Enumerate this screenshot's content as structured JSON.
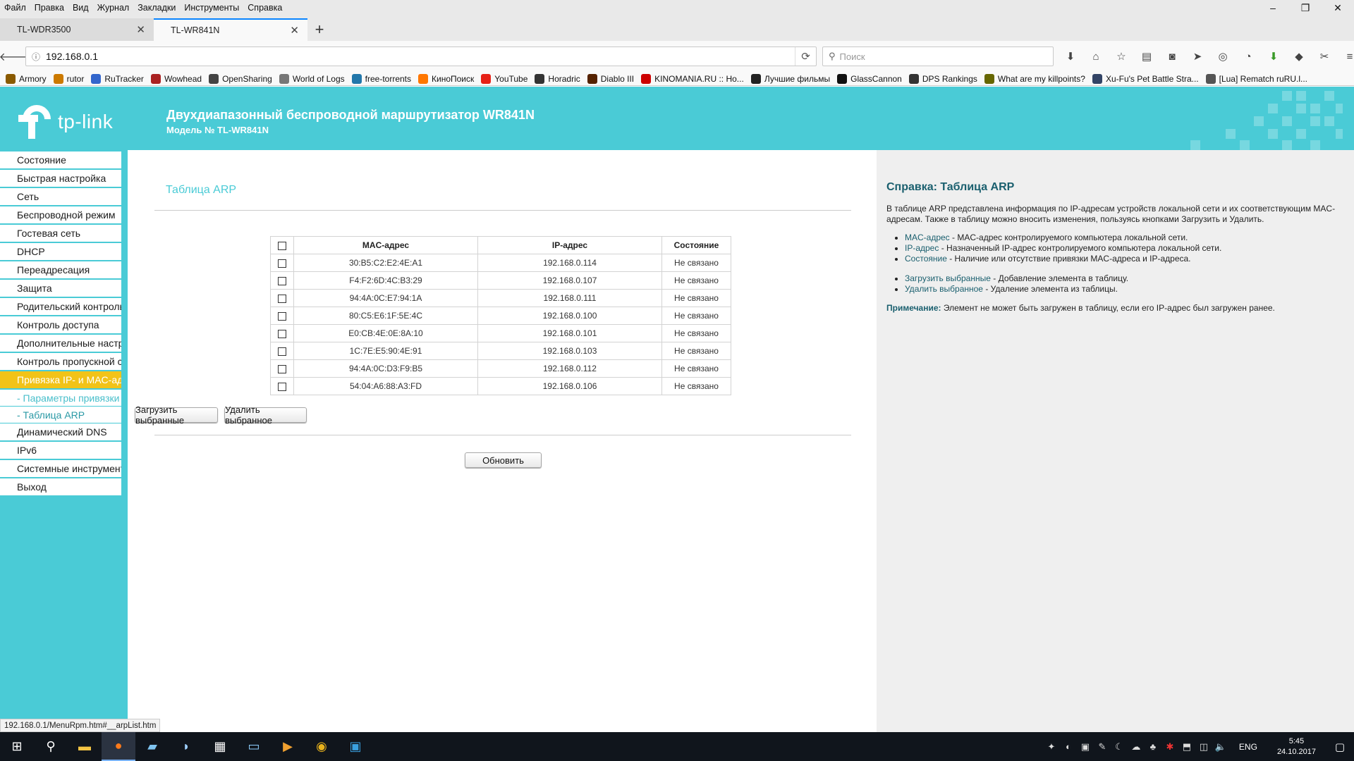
{
  "menubar": {
    "items": [
      "Файл",
      "Правка",
      "Вид",
      "Журнал",
      "Закладки",
      "Инструменты",
      "Справка"
    ],
    "window_controls": [
      "–",
      "❐",
      "✕"
    ]
  },
  "tabs": [
    {
      "title": "TL-WDR3500"
    },
    {
      "title": "TL-WR841N"
    }
  ],
  "navbar": {
    "url": "192.168.0.1",
    "search_placeholder": "Поиск"
  },
  "bookmarks": [
    {
      "label": "Armory",
      "color": "#8a5a00"
    },
    {
      "label": "rutor",
      "color": "#cc7a00"
    },
    {
      "label": "RuTracker",
      "color": "#3366cc"
    },
    {
      "label": "Wowhead",
      "color": "#aa2222"
    },
    {
      "label": "OpenSharing",
      "color": "#444444"
    },
    {
      "label": "World of Logs",
      "color": "#777777"
    },
    {
      "label": "free-torrents",
      "color": "#2277aa"
    },
    {
      "label": "КиноПоиск",
      "color": "#ff7700"
    },
    {
      "label": "YouTube",
      "color": "#e62117"
    },
    {
      "label": "Horadric",
      "color": "#333333"
    },
    {
      "label": "Diablo III",
      "color": "#552200"
    },
    {
      "label": "KINOMANIA.RU :: Ho...",
      "color": "#cc0000"
    },
    {
      "label": "Лучшие фильмы",
      "color": "#222222"
    },
    {
      "label": "GlassCannon",
      "color": "#111111"
    },
    {
      "label": "DPS Rankings",
      "color": "#333333"
    },
    {
      "label": "What are my killpoints?",
      "color": "#666600"
    },
    {
      "label": "Xu-Fu's Pet Battle Stra...",
      "color": "#334466"
    },
    {
      "label": "[Lua] Rematch ruRU.l...",
      "color": "#555555"
    }
  ],
  "header": {
    "brand": "tp-link",
    "title": "Двухдиапазонный беспроводной маршрутизатор WR841N",
    "model": "Модель № TL-WR841N"
  },
  "sidebar": {
    "items": [
      {
        "label": "Состояние"
      },
      {
        "label": "Быстрая настройка"
      },
      {
        "label": "Сеть"
      },
      {
        "label": "Беспроводной режим"
      },
      {
        "label": "Гостевая сеть"
      },
      {
        "label": "DHCP"
      },
      {
        "label": "Переадресация"
      },
      {
        "label": "Защита"
      },
      {
        "label": "Родительский контроль"
      },
      {
        "label": "Контроль доступа"
      },
      {
        "label": "Дополнительные настройки маршрутизации"
      },
      {
        "label": "Контроль пропускной способности"
      },
      {
        "label": "Привязка IP- и MAC-адресов"
      },
      {
        "label": "Динамический DNS"
      },
      {
        "label": "IPv6"
      },
      {
        "label": "Системные инструменты"
      },
      {
        "label": "Выход"
      }
    ],
    "subitems": [
      {
        "label": "- Параметры привязки"
      },
      {
        "label": "- Таблица ARP"
      }
    ]
  },
  "main": {
    "title": "Таблица ARP",
    "columns": [
      "MAC-адрес",
      "IP-адрес",
      "Состояние"
    ],
    "rows": [
      {
        "mac": "30:B5:C2:E2:4E:A1",
        "ip": "192.168.0.114",
        "status": "Не связано"
      },
      {
        "mac": "F4:F2:6D:4C:B3:29",
        "ip": "192.168.0.107",
        "status": "Не связано"
      },
      {
        "mac": "94:4A:0C:E7:94:1A",
        "ip": "192.168.0.111",
        "status": "Не связано"
      },
      {
        "mac": "80:C5:E6:1F:5E:4C",
        "ip": "192.168.0.100",
        "status": "Не связано"
      },
      {
        "mac": "E0:CB:4E:0E:8A:10",
        "ip": "192.168.0.101",
        "status": "Не связано"
      },
      {
        "mac": "1C:7E:E5:90:4E:91",
        "ip": "192.168.0.103",
        "status": "Не связано"
      },
      {
        "mac": "94:4A:0C:D3:F9:B5",
        "ip": "192.168.0.112",
        "status": "Не связано"
      },
      {
        "mac": "54:04:A6:88:A3:FD",
        "ip": "192.168.0.106",
        "status": "Не связано"
      }
    ],
    "btn_load": "Загрузить выбранные",
    "btn_delete": "Удалить выбранное",
    "btn_refresh": "Обновить"
  },
  "help": {
    "title": "Справка: Таблица ARP",
    "intro": "В таблице ARP представлена информация по IP-адресам устройств локальной сети и их соответствующим MAC-адресам. Также в таблицу можно вносить изменения, пользуясь кнопками Загрузить и Удалить.",
    "terms": [
      {
        "term": "MAC-адрес",
        "desc": " - MAC-адрес контролируемого компьютера локальной сети."
      },
      {
        "term": "IP-адрес",
        "desc": " - Назначенный IP-адрес контролируемого компьютера локальной сети."
      },
      {
        "term": "Состояние",
        "desc": " - Наличие или отсутствие привязки MAC-адреса и IP-адреса."
      }
    ],
    "actions": [
      {
        "term": "Загрузить выбранные",
        "desc": " - Добавление элемента в таблицу."
      },
      {
        "term": "Удалить выбранное",
        "desc": " - Удаление элемента из таблицы."
      }
    ],
    "note_label": "Примечание:",
    "note_text": " Элемент не может быть загружен в таблицу, если его IP-адрес был загружен ранее."
  },
  "status_url": "192.168.0.1/MenuRpm.htm#__arpList.htm",
  "taskbar": {
    "lang": "ENG",
    "time": "5:45",
    "date": "24.10.2017"
  },
  "colors": {
    "brand": "#4acbd6",
    "active_menu": "#f2c318",
    "help_title": "#1a5f6e"
  }
}
